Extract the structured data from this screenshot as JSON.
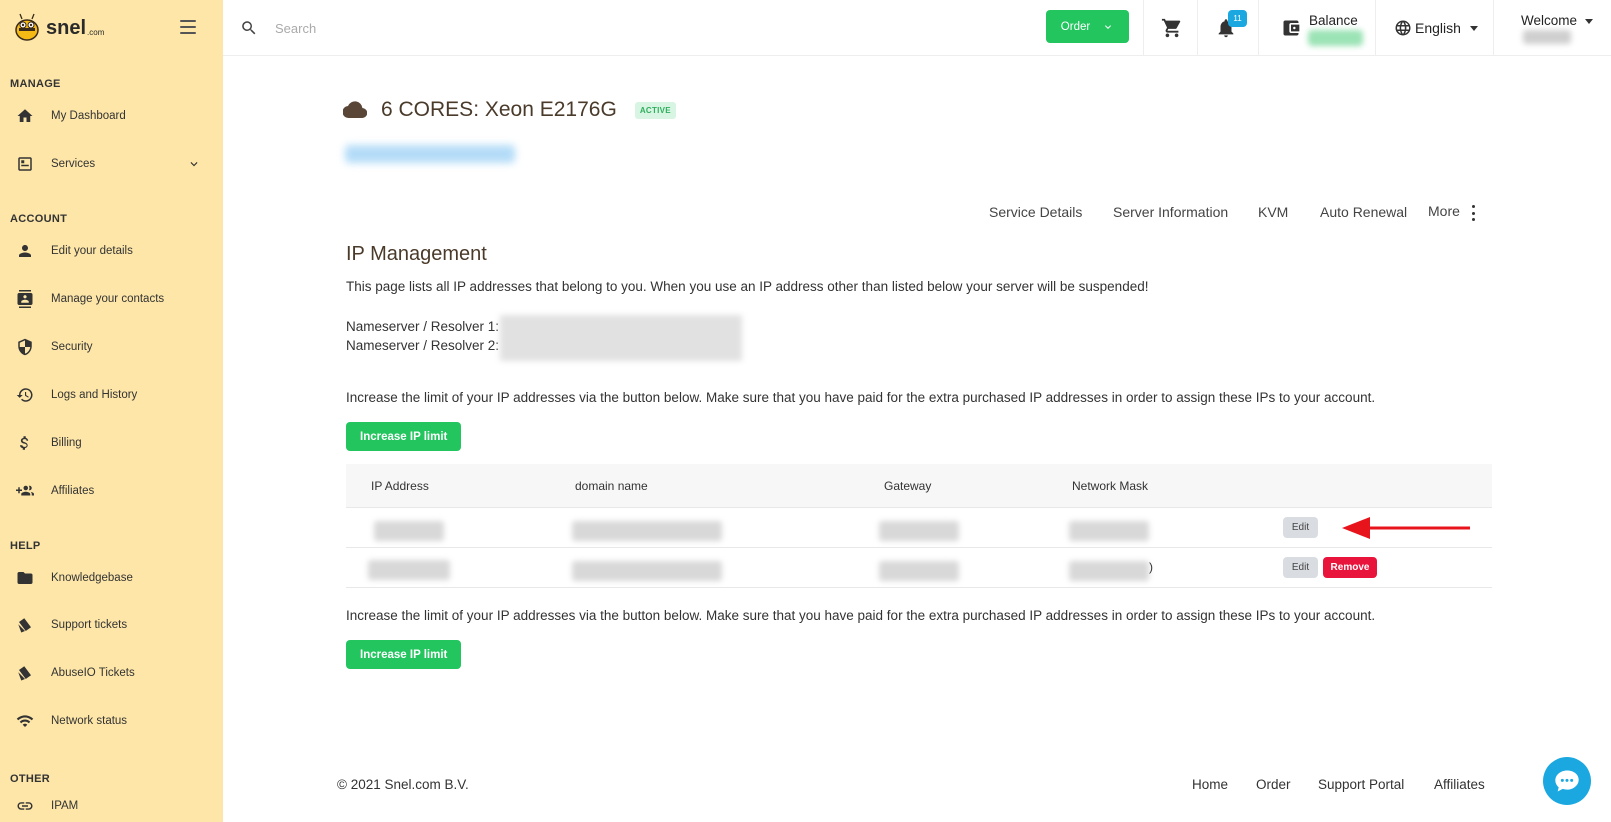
{
  "brand": {
    "name": "snel",
    "suffix": ".com"
  },
  "sidebar": {
    "sections": [
      {
        "title": "MANAGE"
      },
      {
        "title": "ACCOUNT"
      },
      {
        "title": "HELP"
      },
      {
        "title": "OTHER"
      }
    ],
    "items": [
      {
        "label": "My Dashboard",
        "icon": "home-icon"
      },
      {
        "label": "Services",
        "icon": "services-icon"
      },
      {
        "label": "Edit your details",
        "icon": "person-icon"
      },
      {
        "label": "Manage your contacts",
        "icon": "contacts-icon"
      },
      {
        "label": "Security",
        "icon": "shield-icon"
      },
      {
        "label": "Logs and History",
        "icon": "history-icon"
      },
      {
        "label": "Billing",
        "icon": "dollar-icon"
      },
      {
        "label": "Affiliates",
        "icon": "group-add-icon"
      },
      {
        "label": "Knowledgebase",
        "icon": "folder-icon"
      },
      {
        "label": "Support tickets",
        "icon": "tickets-icon"
      },
      {
        "label": "AbuseIO Tickets",
        "icon": "tickets-icon"
      },
      {
        "label": "Network status",
        "icon": "wifi-icon"
      },
      {
        "label": "IPAM",
        "icon": "link-icon"
      }
    ]
  },
  "topbar": {
    "search_placeholder": "Search",
    "order_label": "Order",
    "notification_count": "11",
    "balance_label": "Balance",
    "language": "English",
    "welcome_label": "Welcome"
  },
  "service": {
    "title": "6 CORES: Xeon E2176G",
    "status": "ACTIVE"
  },
  "tabs": [
    "Service Details",
    "Server Information",
    "KVM",
    "Auto Renewal",
    "More"
  ],
  "ip_management": {
    "title": "IP Management",
    "intro": "This page lists all IP addresses that belong to you. When you use an IP address other than listed below your server will be suspended!",
    "ns1_label": "Nameserver / Resolver 1:",
    "ns2_label": "Nameserver / Resolver 2:",
    "limit_note": "Increase the limit of your IP addresses via the button below. Make sure that you have paid for the extra purchased IP addresses in order to assign these IPs to your account.",
    "increase_btn": "Increase IP limit",
    "columns": [
      "IP Address",
      "domain name",
      "Gateway",
      "Network Mask"
    ],
    "edit_label": "Edit",
    "remove_label": "Remove",
    "row2_mask_tail": ")"
  },
  "footer": {
    "copyright": "© 2021 Snel.com B.V.",
    "links": [
      "Home",
      "Order",
      "Support Portal",
      "Affiliates"
    ]
  },
  "colors": {
    "sidebar_bg": "#fde6a8",
    "accent_green": "#22c55e",
    "danger_red": "#e8143c",
    "info_blue": "#1ba8e0"
  }
}
